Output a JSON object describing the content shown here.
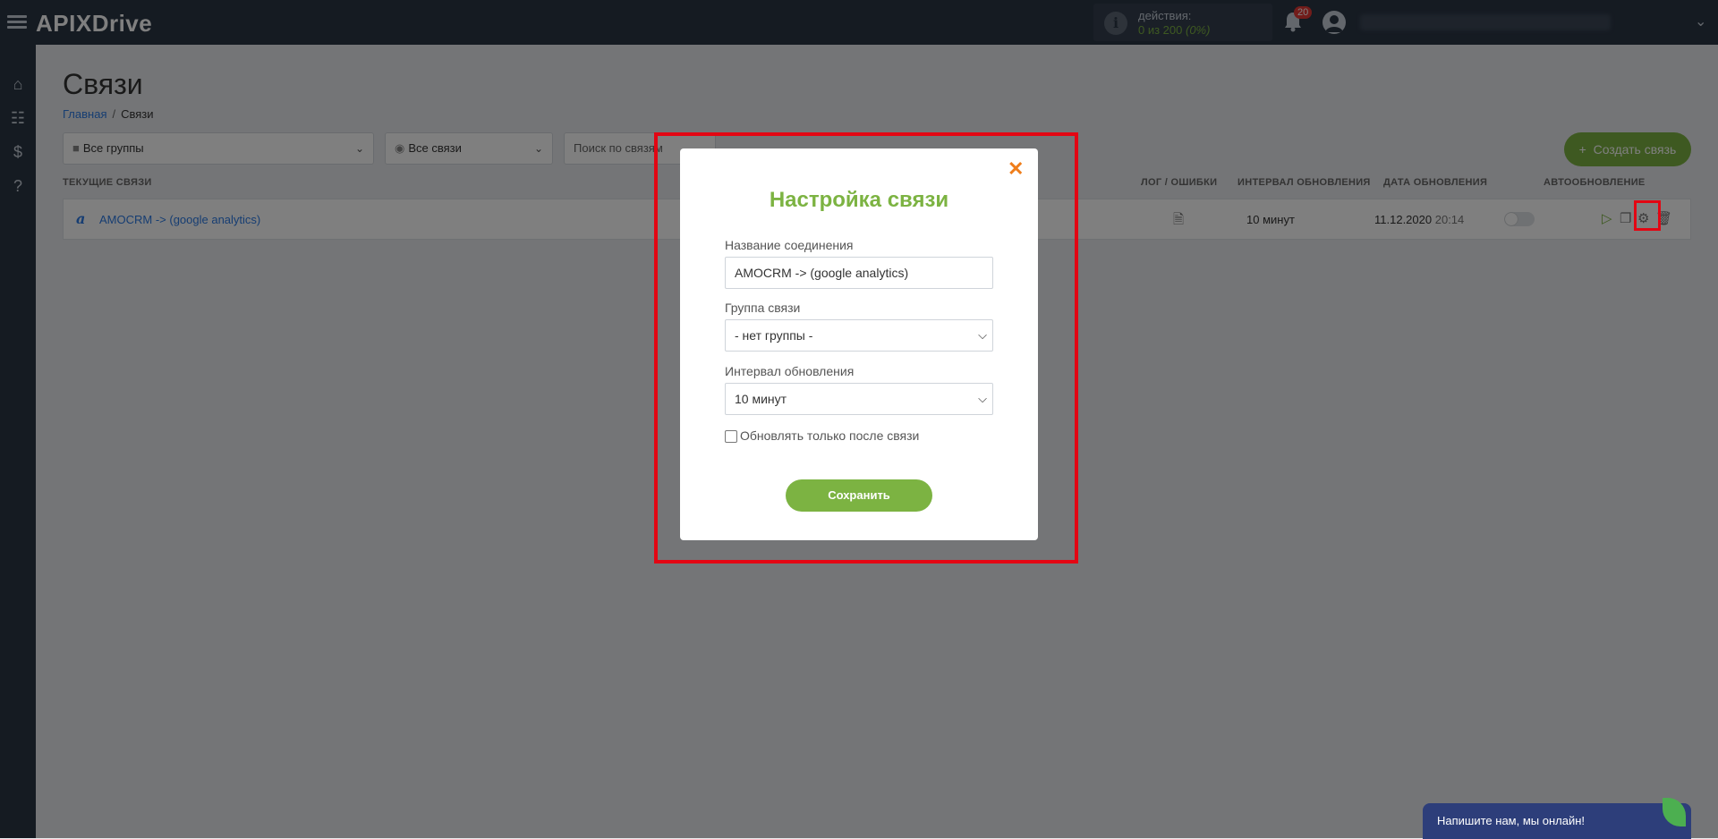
{
  "header": {
    "logo_main": "APIX",
    "logo_accent": "Drive",
    "actions_label": "действия:",
    "actions_value": "0 из 200",
    "actions_percent": "(0%)",
    "notifications_count": "20"
  },
  "page": {
    "title": "Связи",
    "breadcrumb": {
      "home": "Главная",
      "separator": "/",
      "current": "Связи"
    }
  },
  "filters": {
    "groups": "Все группы",
    "connections": "Все связи",
    "search_placeholder": "Поиск по связям"
  },
  "create_button": "Создать связь",
  "table": {
    "headers": {
      "current": "ТЕКУЩИЕ СВЯЗИ",
      "log": "ЛОГ / ОШИБКИ",
      "interval": "ИНТЕРВАЛ ОБНОВЛЕНИЯ",
      "date": "ДАТА ОБНОВЛЕНИЯ",
      "auto": "АВТООБНОВЛЕНИЕ"
    },
    "rows": [
      {
        "icon_letter": "a",
        "name": "AMOCRM -> (google analytics)",
        "interval": "10 минут",
        "date": "11.12.2020",
        "time": "20:14",
        "autoupdate": false
      }
    ]
  },
  "modal": {
    "title": "Настройка связи",
    "name_label": "Название соединения",
    "name_value": "AMOCRM -> (google analytics)",
    "group_label": "Группа связи",
    "group_value": "- нет группы -",
    "interval_label": "Интервал обновления",
    "interval_value": "10 минут",
    "checkbox_label": "Обновлять только после связи",
    "checkbox_checked": false,
    "save_label": "Сохранить"
  },
  "chat": {
    "label": "Напишите нам, мы онлайн!"
  },
  "colors": {
    "accent_green": "#7cb342",
    "highlight_red": "#e30613",
    "close_orange": "#ef7d1a",
    "header_dark": "#2b3645"
  }
}
